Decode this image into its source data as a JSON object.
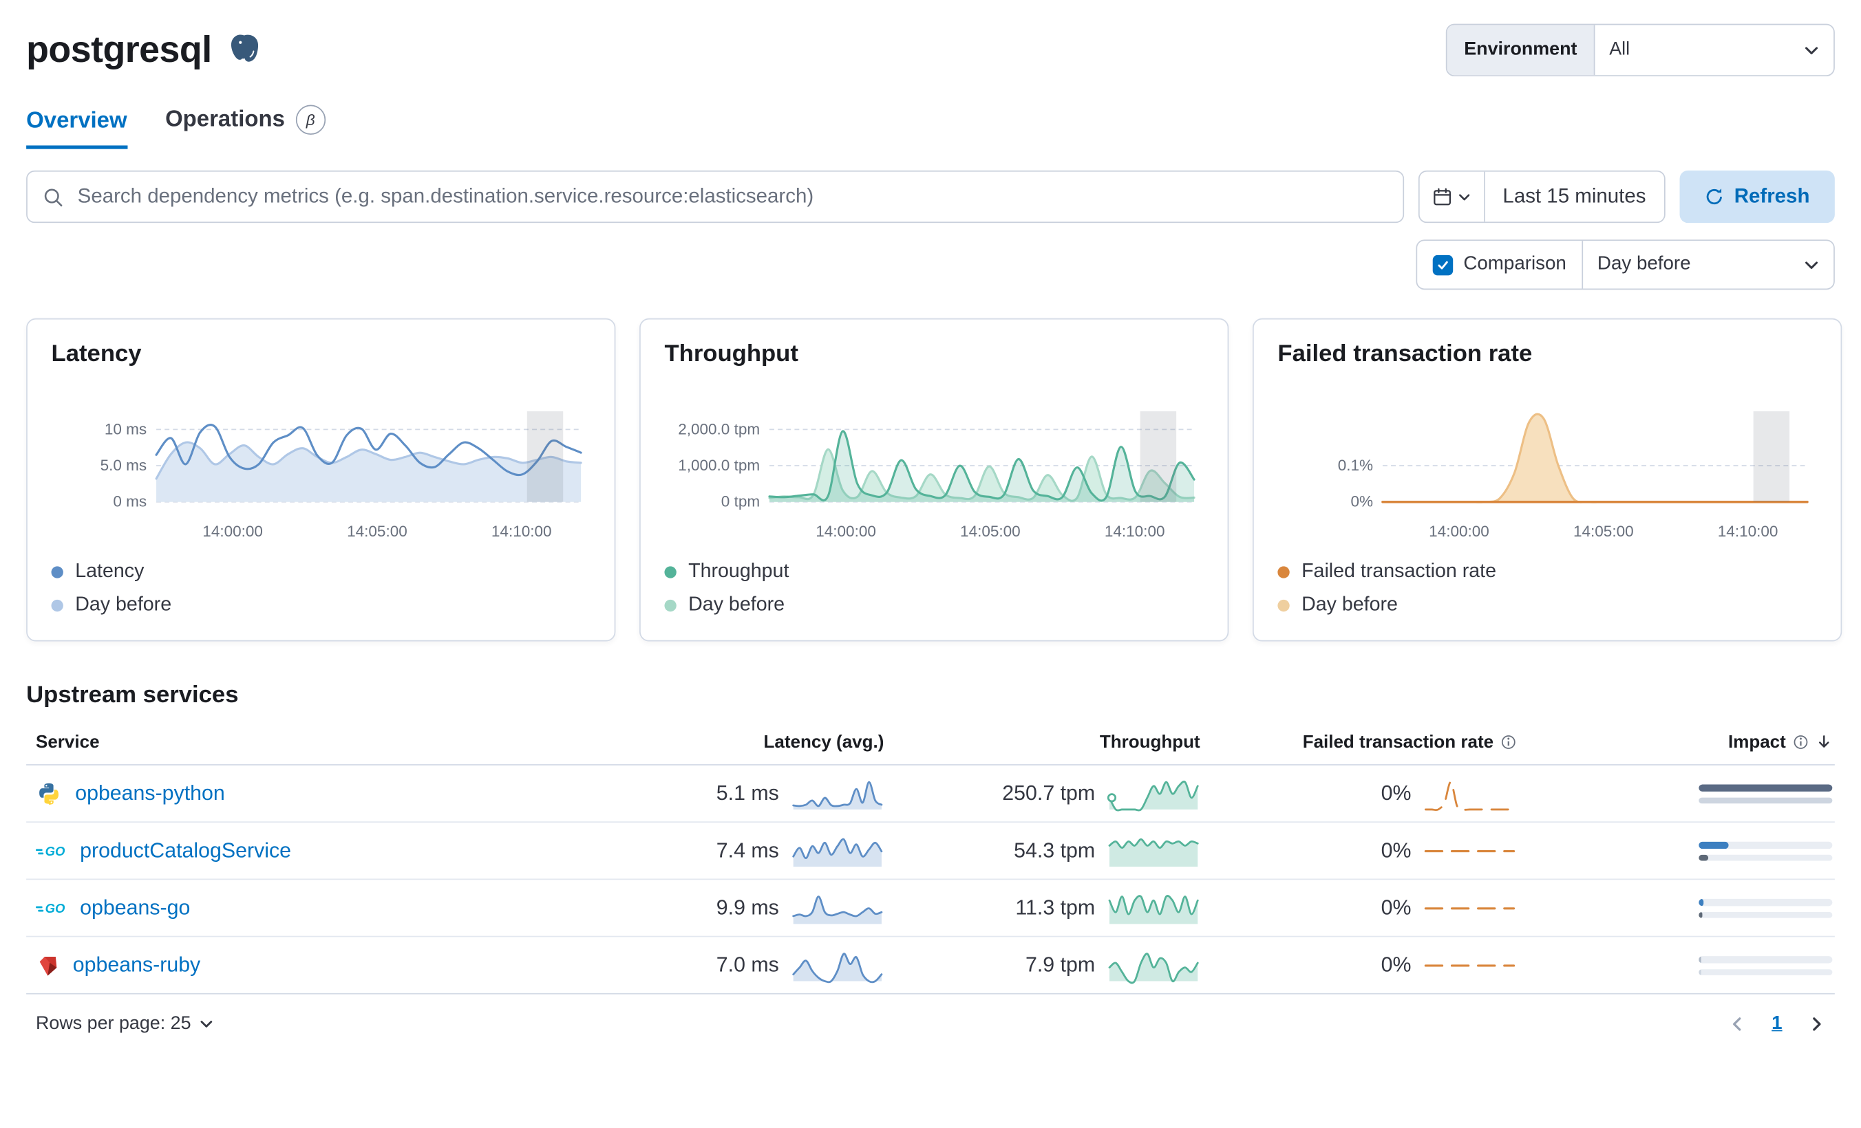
{
  "header": {
    "title": "postgresql",
    "environment_label": "Environment",
    "environment_value": "All"
  },
  "tabs": [
    {
      "label": "Overview"
    },
    {
      "label": "Operations",
      "badge": "β"
    }
  ],
  "toolbar": {
    "search_placeholder": "Search dependency metrics (e.g. span.destination.service.resource:elasticsearch)",
    "time_range": "Last 15 minutes",
    "refresh_label": "Refresh",
    "comparison_label": "Comparison",
    "comparison_value": "Day before"
  },
  "charts": [
    {
      "title": "Latency",
      "type": "line",
      "ymax": 12.5,
      "y_ticks": [
        {
          "value": 10,
          "label": "10 ms"
        },
        {
          "value": 5,
          "label": "5.0 ms"
        },
        {
          "value": 0,
          "label": "0 ms"
        }
      ],
      "x_ticks": [
        {
          "pos": 0.18,
          "label": "14:00:00"
        },
        {
          "pos": 0.52,
          "label": "14:05:00"
        },
        {
          "pos": 0.86,
          "label": "14:10:00"
        }
      ],
      "series": [
        {
          "name": "Day before",
          "color": "#AFC7E6",
          "fill": "#DCE7F4",
          "values": [
            3.2,
            6.6,
            8.2,
            7.4,
            5.2,
            6.6,
            7.8,
            6.2,
            5.2,
            6.6,
            7.4,
            6.2,
            5.4,
            6.2,
            7.2,
            6.6,
            5.8,
            6.2,
            6.8,
            6.2,
            5.6,
            5.2,
            5.8,
            6.2,
            6.0,
            5.4,
            5.8,
            6.2,
            5.6,
            5.4
          ]
        },
        {
          "name": "Latency",
          "color": "#5E8EC6",
          "fill": "none",
          "values": [
            6.5,
            8.8,
            5.2,
            9.6,
            10.4,
            6.2,
            4.6,
            5.2,
            8.2,
            9.2,
            10.2,
            6.4,
            5.4,
            9.2,
            10.1,
            7.2,
            9.4,
            7.8,
            5.4,
            4.8,
            6.6,
            8.2,
            7.4,
            5.8,
            4.2,
            3.8,
            5.6,
            8.4,
            7.6,
            6.8
          ]
        }
      ],
      "legend": [
        {
          "label": "Latency",
          "color": "#5E8EC6"
        },
        {
          "label": "Day before",
          "color": "#AFC7E6"
        }
      ]
    },
    {
      "title": "Throughput",
      "type": "area",
      "ymax": 2500,
      "y_ticks": [
        {
          "value": 2000,
          "label": "2,000.0 tpm"
        },
        {
          "value": 1000,
          "label": "1,000.0 tpm"
        },
        {
          "value": 0,
          "label": "0 tpm"
        }
      ],
      "x_ticks": [
        {
          "pos": 0.18,
          "label": "14:00:00"
        },
        {
          "pos": 0.52,
          "label": "14:05:00"
        },
        {
          "pos": 0.86,
          "label": "14:10:00"
        }
      ],
      "series": [
        {
          "name": "Day before",
          "color": "#A5D8C6",
          "fill": "#D4EEE4",
          "values": [
            110,
            150,
            130,
            190,
            1450,
            320,
            140,
            850,
            260,
            120,
            160,
            760,
            210,
            110,
            160,
            980,
            260,
            130,
            110,
            740,
            190,
            110,
            1250,
            210,
            110,
            130,
            860,
            520,
            140,
            120
          ]
        },
        {
          "name": "Throughput",
          "color": "#54B399",
          "fill": "rgba(84,179,153,0.22)",
          "values": [
            150,
            130,
            170,
            210,
            160,
            1950,
            500,
            180,
            250,
            1150,
            350,
            160,
            180,
            1000,
            280,
            140,
            190,
            1180,
            320,
            160,
            130,
            950,
            240,
            130,
            1520,
            280,
            160,
            140,
            1080,
            620
          ]
        }
      ],
      "legend": [
        {
          "label": "Throughput",
          "color": "#54B399"
        },
        {
          "label": "Day before",
          "color": "#A5D8C6"
        }
      ]
    },
    {
      "title": "Failed transaction rate",
      "type": "area",
      "ymax": 0.25,
      "y_ticks": [
        {
          "value": 0.1,
          "label": "0.1%"
        },
        {
          "value": 0,
          "label": "0%"
        }
      ],
      "x_ticks": [
        {
          "pos": 0.18,
          "label": "14:00:00"
        },
        {
          "pos": 0.52,
          "label": "14:05:00"
        },
        {
          "pos": 0.86,
          "label": "14:10:00"
        }
      ],
      "series": [
        {
          "name": "Day before",
          "color": "#EDBF85",
          "fill": "#F7E0BE",
          "values": [
            0,
            0,
            0,
            0,
            0,
            0,
            0,
            0,
            0.01,
            0.08,
            0.22,
            0.23,
            0.1,
            0.01,
            0,
            0,
            0,
            0,
            0,
            0,
            0,
            0,
            0,
            0,
            0,
            0,
            0,
            0,
            0,
            0
          ]
        },
        {
          "name": "Failed transaction rate",
          "color": "#D9863C",
          "fill": "none",
          "width": 2,
          "values": [
            0,
            0,
            0,
            0,
            0,
            0,
            0,
            0,
            0,
            0,
            0,
            0,
            0,
            0,
            0,
            0,
            0,
            0,
            0,
            0,
            0,
            0,
            0,
            0,
            0,
            0,
            0,
            0,
            0,
            0
          ]
        }
      ],
      "legend": [
        {
          "label": "Failed transaction rate",
          "color": "#D9863C"
        },
        {
          "label": "Day before",
          "color": "#EFCF9F"
        }
      ]
    }
  ],
  "table": {
    "section_title": "Upstream services",
    "columns": [
      "Service",
      "Latency (avg.)",
      "Throughput",
      "Failed transaction rate",
      "Impact"
    ],
    "spark_colors": {
      "latency": "#5E8EC6",
      "latency_fill": "rgba(94,142,198,0.25)",
      "throughput": "#54B399",
      "throughput_fill": "rgba(84,179,153,0.28)",
      "failed": "#D9863C"
    },
    "rows": [
      {
        "service": "opbeans-python",
        "icon": "python",
        "latency": "5.1 ms",
        "throughput": "250.7 tpm",
        "failed_rate": "0%",
        "latency_spark": [
          1.2,
          1,
          1.4,
          2.6,
          1,
          3.4,
          1.3,
          1,
          1.4,
          1.8,
          6,
          2,
          8,
          2.6,
          1.4
        ],
        "throughput_spark": [
          3,
          0,
          0,
          0,
          0,
          0,
          3,
          6,
          4,
          7,
          4,
          6,
          7,
          3,
          6
        ],
        "throughput_dot": true,
        "failed_spark": [
          0,
          0,
          0,
          2,
          8,
          1,
          0,
          0,
          0,
          0,
          0,
          0,
          0,
          0,
          0
        ],
        "impact": {
          "current": {
            "pct": 100,
            "color": "#5A6A84"
          },
          "previous": {
            "pct": 100,
            "color": "#CDD5E0"
          }
        }
      },
      {
        "service": "productCatalogService",
        "icon": "go",
        "latency": "7.4 ms",
        "throughput": "54.3 tpm",
        "failed_rate": "0%",
        "latency_spark": [
          3,
          5.5,
          2.5,
          6,
          4,
          7,
          3.5,
          6,
          8,
          4,
          6.5,
          3,
          5,
          7,
          4.5
        ],
        "throughput_spark": [
          5,
          6,
          4.5,
          6,
          5,
          6.5,
          5,
          6,
          4.5,
          6,
          5.5,
          6,
          5,
          6,
          5.5
        ],
        "throughput_dot": false,
        "failed_spark": [
          0,
          0,
          0,
          0,
          0,
          0,
          0,
          0,
          0,
          0,
          0,
          0,
          0,
          0,
          0
        ],
        "impact": {
          "current": {
            "pct": 22,
            "color": "#3C7FC0"
          },
          "previous": {
            "pct": 7,
            "color": "#5E6977"
          }
        }
      },
      {
        "service": "opbeans-go",
        "icon": "go",
        "latency": "9.9 ms",
        "throughput": "11.3 tpm",
        "failed_rate": "0%",
        "latency_spark": [
          2,
          2.4,
          2,
          3,
          7,
          3,
          2.2,
          2.6,
          3,
          2.4,
          2,
          3,
          4,
          2.6,
          3
        ],
        "throughput_spark": [
          6,
          3,
          7,
          2.5,
          6,
          7,
          3,
          6,
          2.5,
          7,
          6,
          3,
          7,
          2.5,
          6
        ],
        "throughput_dot": false,
        "failed_spark": [
          0,
          0,
          0,
          0,
          0,
          0,
          0,
          0,
          0,
          0,
          0,
          0,
          0,
          0,
          0
        ],
        "impact": {
          "current": {
            "pct": 4,
            "color": "#3C7FC0"
          },
          "previous": {
            "pct": 3,
            "color": "#5E6977"
          }
        }
      },
      {
        "service": "opbeans-ruby",
        "icon": "ruby",
        "latency": "7.0 ms",
        "throughput": "7.9 tpm",
        "failed_rate": "0%",
        "latency_spark": [
          2,
          4,
          6,
          3,
          1,
          0,
          0,
          3,
          8,
          5,
          7,
          2,
          0,
          0,
          2
        ],
        "throughput_spark": [
          3,
          4,
          2,
          0,
          0,
          4,
          6,
          3,
          5,
          4,
          0,
          2,
          3,
          2,
          4
        ],
        "throughput_dot": false,
        "failed_spark": [
          0,
          0,
          0,
          0,
          0,
          0,
          0,
          0,
          0,
          0,
          0,
          0,
          0,
          0,
          0
        ],
        "impact": {
          "current": {
            "pct": 2,
            "color": "#AEB9C7"
          },
          "previous": {
            "pct": 2,
            "color": "#CDD5E0"
          }
        }
      }
    ]
  },
  "footer": {
    "rows_per_page_label": "Rows per page: 25",
    "page": "1"
  }
}
